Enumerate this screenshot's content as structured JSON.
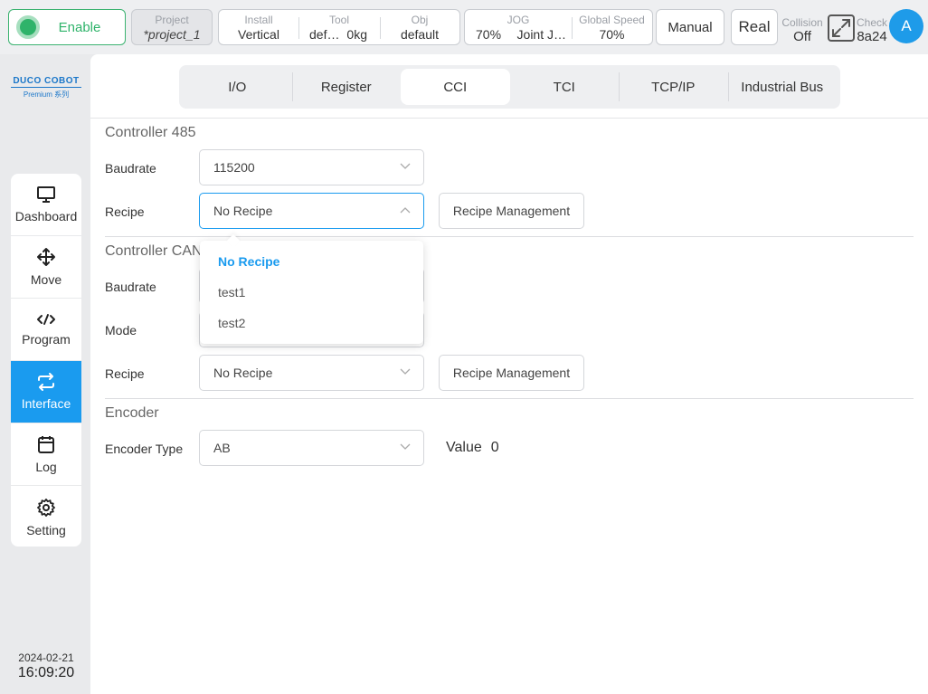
{
  "topbar": {
    "enable_label": "Enable",
    "project": {
      "caption": "Project",
      "value": "*project_1"
    },
    "install": {
      "caption": "Install",
      "value": "Vertical"
    },
    "tool": {
      "caption": "Tool",
      "name": "def…",
      "mass": "0kg"
    },
    "obj": {
      "caption": "Obj",
      "value": "default"
    },
    "jog": {
      "caption": "JOG",
      "speed": "70%",
      "mode": "Joint J…"
    },
    "global_speed": {
      "caption": "Global Speed",
      "value": "70%"
    },
    "mode_label": "Manual",
    "run_label": "Real",
    "collision": {
      "caption": "Collision",
      "value": "Off"
    },
    "check": {
      "caption": "Check",
      "value": "8a24"
    },
    "avatar_letter": "A"
  },
  "brand": {
    "name": "DUCO COBOT",
    "sub": "Premium 系列"
  },
  "nav": [
    {
      "label": "Dashboard",
      "icon": "monitor-icon"
    },
    {
      "label": "Move",
      "icon": "move-arrows-icon"
    },
    {
      "label": "Program",
      "icon": "code-icon"
    },
    {
      "label": "Interface",
      "icon": "swap-arrows-icon",
      "active": true
    },
    {
      "label": "Log",
      "icon": "calendar-icon"
    },
    {
      "label": "Setting",
      "icon": "gear-icon"
    }
  ],
  "datetime": {
    "date": "2024-02-21",
    "time": "16:09:20"
  },
  "tabs": [
    "I/O",
    "Register",
    "CCI",
    "TCI",
    "TCP/IP",
    "Industrial Bus"
  ],
  "active_tab": "CCI",
  "sections": {
    "c485": {
      "title": "Controller 485",
      "baudrate_label": "Baudrate",
      "baudrate_value": "115200",
      "recipe_label": "Recipe",
      "recipe_value": "No Recipe",
      "recipe_button": "Recipe Management"
    },
    "can": {
      "title": "Controller CAN",
      "baudrate_label": "Baudrate",
      "mode_label": "Mode",
      "recipe_label": "Recipe",
      "recipe_value": "No Recipe",
      "recipe_button": "Recipe Management"
    },
    "encoder": {
      "title": "Encoder",
      "type_label": "Encoder Type",
      "type_value": "AB",
      "value_label": "Value",
      "value": "0"
    }
  },
  "dropdown": {
    "options": [
      "No Recipe",
      "test1",
      "test2"
    ],
    "selected": "No Recipe"
  },
  "colors": {
    "accent": "#1a9bef",
    "enable_green": "#2fb36a"
  }
}
